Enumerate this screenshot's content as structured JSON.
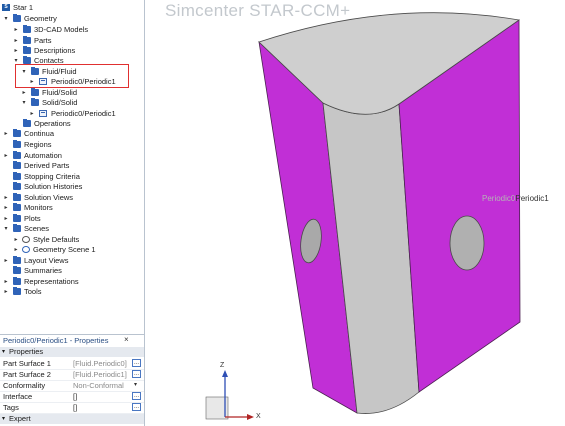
{
  "tree": {
    "root": "Star 1",
    "items": [
      {
        "label": "Geometry"
      },
      {
        "label": "3D-CAD Models"
      },
      {
        "label": "Parts"
      },
      {
        "label": "Descriptions"
      },
      {
        "label": "Contacts"
      },
      {
        "label": "Fluid/Fluid"
      },
      {
        "label": "Periodic0/Periodic1"
      },
      {
        "label": "Fluid/Solid"
      },
      {
        "label": "Solid/Solid"
      },
      {
        "label": "Periodic0/Periodic1"
      },
      {
        "label": "Operations"
      },
      {
        "label": "Continua"
      },
      {
        "label": "Regions"
      },
      {
        "label": "Automation"
      },
      {
        "label": "Derived Parts"
      },
      {
        "label": "Stopping Criteria"
      },
      {
        "label": "Solution Histories"
      },
      {
        "label": "Solution Views"
      },
      {
        "label": "Monitors"
      },
      {
        "label": "Plots"
      },
      {
        "label": "Scenes"
      },
      {
        "label": "Style Defaults"
      },
      {
        "label": "Geometry Scene 1"
      },
      {
        "label": "Layout Views"
      },
      {
        "label": "Summaries"
      },
      {
        "label": "Representations"
      },
      {
        "label": "Tools"
      }
    ]
  },
  "properties": {
    "title": "Periodic0/Periodic1 - Properties",
    "close": "×",
    "section": "Properties",
    "rows": [
      {
        "key": "Part Surface 1",
        "value": "[Fluid.Periodic0]"
      },
      {
        "key": "Part Surface 2",
        "value": "[Fluid.Periodic1]"
      },
      {
        "key": "Conformality",
        "value": "Non-Conformal"
      },
      {
        "key": "Interface",
        "value": "[]"
      },
      {
        "key": "Tags",
        "value": "[]"
      }
    ],
    "expert": "Expert",
    "button_label": "..."
  },
  "viewport": {
    "app_title": "Simcenter STAR-CCM+",
    "part_label_faded": "Periodic0",
    "part_label": "Periodic1",
    "axis_z": "Z",
    "axis_x": "X",
    "colors": {
      "periodic_face": "#c12fd6",
      "body": "#c6c6c6"
    }
  }
}
